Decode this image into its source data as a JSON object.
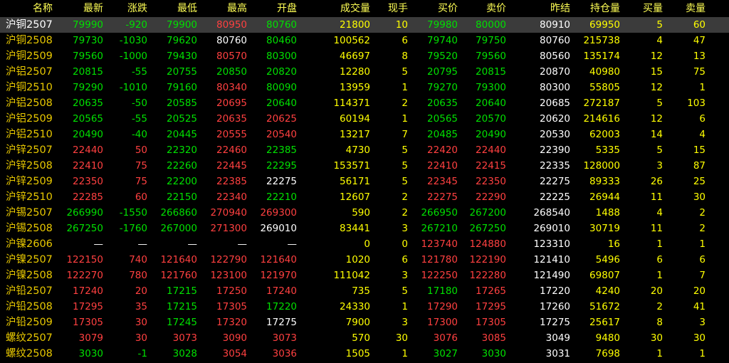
{
  "columns": [
    "名称",
    "最新",
    "涨跌",
    "最低",
    "最高",
    "开盘",
    "成交量",
    "现手",
    "买价",
    "卖价",
    "昨结",
    "持仓量",
    "买量",
    "卖量"
  ],
  "colors": {
    "up": "#ff4040",
    "down": "#00e000",
    "flat": "#ffffff",
    "volume": "#ffff00",
    "header": "#ffff55",
    "name": "#e8c800",
    "selected_bg": "#3b3b3b"
  },
  "rows": [
    {
      "name": "沪铜2507",
      "last": "79990",
      "chg": "-920",
      "low": "79900",
      "high": "80950",
      "open": "80760",
      "vol": "21800",
      "cur": "10",
      "bid": "79980",
      "ask": "80000",
      "prev": "80910",
      "oi": "69950",
      "bidv": "5",
      "askv": "60",
      "selected": true,
      "c": {
        "name": "w",
        "last": "g",
        "chg": "g",
        "low": "g",
        "high": "r",
        "open": "g",
        "bid": "g",
        "ask": "g",
        "prev": "w"
      }
    },
    {
      "name": "沪铜2508",
      "last": "79730",
      "chg": "-1030",
      "low": "79620",
      "high": "80760",
      "open": "80460",
      "vol": "100562",
      "cur": "6",
      "bid": "79740",
      "ask": "79750",
      "prev": "80760",
      "oi": "215738",
      "bidv": "4",
      "askv": "47",
      "c": {
        "name": "y",
        "last": "g",
        "chg": "g",
        "low": "g",
        "high": "w",
        "open": "g",
        "bid": "g",
        "ask": "g",
        "prev": "w"
      }
    },
    {
      "name": "沪铜2509",
      "last": "79560",
      "chg": "-1000",
      "low": "79430",
      "high": "80570",
      "open": "80300",
      "vol": "46697",
      "cur": "8",
      "bid": "79520",
      "ask": "79560",
      "prev": "80560",
      "oi": "135174",
      "bidv": "12",
      "askv": "13",
      "c": {
        "name": "y",
        "last": "g",
        "chg": "g",
        "low": "g",
        "high": "r",
        "open": "g",
        "bid": "g",
        "ask": "g",
        "prev": "w"
      }
    },
    {
      "name": "沪铝2507",
      "last": "20815",
      "chg": "-55",
      "low": "20755",
      "high": "20850",
      "open": "20820",
      "vol": "12280",
      "cur": "5",
      "bid": "20795",
      "ask": "20815",
      "prev": "20870",
      "oi": "40980",
      "bidv": "15",
      "askv": "75",
      "c": {
        "name": "y",
        "last": "g",
        "chg": "g",
        "low": "g",
        "high": "g",
        "open": "g",
        "bid": "g",
        "ask": "g",
        "prev": "w"
      }
    },
    {
      "name": "沪铜2510",
      "last": "79290",
      "chg": "-1010",
      "low": "79160",
      "high": "80340",
      "open": "80090",
      "vol": "13959",
      "cur": "1",
      "bid": "79270",
      "ask": "79300",
      "prev": "80300",
      "oi": "55805",
      "bidv": "12",
      "askv": "1",
      "c": {
        "name": "y",
        "last": "g",
        "chg": "g",
        "low": "g",
        "high": "r",
        "open": "g",
        "bid": "g",
        "ask": "g",
        "prev": "w"
      }
    },
    {
      "name": "沪铝2508",
      "last": "20635",
      "chg": "-50",
      "low": "20585",
      "high": "20695",
      "open": "20640",
      "vol": "114371",
      "cur": "2",
      "bid": "20635",
      "ask": "20640",
      "prev": "20685",
      "oi": "272187",
      "bidv": "5",
      "askv": "103",
      "c": {
        "name": "y",
        "last": "g",
        "chg": "g",
        "low": "g",
        "high": "r",
        "open": "g",
        "bid": "g",
        "ask": "g",
        "prev": "w"
      }
    },
    {
      "name": "沪铝2509",
      "last": "20565",
      "chg": "-55",
      "low": "20525",
      "high": "20635",
      "open": "20625",
      "vol": "60194",
      "cur": "1",
      "bid": "20565",
      "ask": "20570",
      "prev": "20620",
      "oi": "214616",
      "bidv": "12",
      "askv": "6",
      "c": {
        "name": "y",
        "last": "g",
        "chg": "g",
        "low": "g",
        "high": "r",
        "open": "r",
        "bid": "g",
        "ask": "g",
        "prev": "w"
      }
    },
    {
      "name": "沪铝2510",
      "last": "20490",
      "chg": "-40",
      "low": "20445",
      "high": "20555",
      "open": "20540",
      "vol": "13217",
      "cur": "7",
      "bid": "20485",
      "ask": "20490",
      "prev": "20530",
      "oi": "62003",
      "bidv": "14",
      "askv": "4",
      "c": {
        "name": "y",
        "last": "g",
        "chg": "g",
        "low": "g",
        "high": "r",
        "open": "r",
        "bid": "g",
        "ask": "g",
        "prev": "w"
      }
    },
    {
      "name": "沪锌2507",
      "last": "22440",
      "chg": "50",
      "low": "22320",
      "high": "22460",
      "open": "22385",
      "vol": "4730",
      "cur": "5",
      "bid": "22420",
      "ask": "22440",
      "prev": "22390",
      "oi": "5335",
      "bidv": "5",
      "askv": "15",
      "c": {
        "name": "y",
        "last": "r",
        "chg": "r",
        "low": "g",
        "high": "r",
        "open": "g",
        "bid": "r",
        "ask": "r",
        "prev": "w"
      }
    },
    {
      "name": "沪锌2508",
      "last": "22410",
      "chg": "75",
      "low": "22260",
      "high": "22445",
      "open": "22295",
      "vol": "153571",
      "cur": "5",
      "bid": "22410",
      "ask": "22415",
      "prev": "22335",
      "oi": "128000",
      "bidv": "3",
      "askv": "87",
      "c": {
        "name": "y",
        "last": "r",
        "chg": "r",
        "low": "g",
        "high": "r",
        "open": "g",
        "bid": "r",
        "ask": "r",
        "prev": "w"
      }
    },
    {
      "name": "沪锌2509",
      "last": "22350",
      "chg": "75",
      "low": "22200",
      "high": "22385",
      "open": "22275",
      "vol": "56171",
      "cur": "5",
      "bid": "22345",
      "ask": "22350",
      "prev": "22275",
      "oi": "89333",
      "bidv": "26",
      "askv": "25",
      "c": {
        "name": "y",
        "last": "r",
        "chg": "r",
        "low": "g",
        "high": "r",
        "open": "w",
        "bid": "r",
        "ask": "r",
        "prev": "w"
      }
    },
    {
      "name": "沪锌2510",
      "last": "22285",
      "chg": "60",
      "low": "22150",
      "high": "22340",
      "open": "22210",
      "vol": "12607",
      "cur": "2",
      "bid": "22275",
      "ask": "22290",
      "prev": "22225",
      "oi": "26944",
      "bidv": "11",
      "askv": "30",
      "c": {
        "name": "y",
        "last": "r",
        "chg": "r",
        "low": "g",
        "high": "r",
        "open": "g",
        "bid": "r",
        "ask": "r",
        "prev": "w"
      }
    },
    {
      "name": "沪锡2507",
      "last": "266990",
      "chg": "-1550",
      "low": "266860",
      "high": "270940",
      "open": "269300",
      "vol": "590",
      "cur": "2",
      "bid": "266950",
      "ask": "267200",
      "prev": "268540",
      "oi": "1488",
      "bidv": "4",
      "askv": "2",
      "c": {
        "name": "y",
        "last": "g",
        "chg": "g",
        "low": "g",
        "high": "r",
        "open": "r",
        "bid": "g",
        "ask": "g",
        "prev": "w"
      }
    },
    {
      "name": "沪锡2508",
      "last": "267250",
      "chg": "-1760",
      "low": "267000",
      "high": "271300",
      "open": "269010",
      "vol": "83441",
      "cur": "3",
      "bid": "267210",
      "ask": "267250",
      "prev": "269010",
      "oi": "30719",
      "bidv": "11",
      "askv": "2",
      "c": {
        "name": "y",
        "last": "g",
        "chg": "g",
        "low": "g",
        "high": "r",
        "open": "w",
        "bid": "g",
        "ask": "g",
        "prev": "w"
      }
    },
    {
      "name": "沪镍2606",
      "last": "—",
      "chg": "—",
      "low": "—",
      "high": "—",
      "open": "—",
      "vol": "0",
      "cur": "0",
      "bid": "123740",
      "ask": "124880",
      "prev": "123310",
      "oi": "16",
      "bidv": "1",
      "askv": "1",
      "c": {
        "name": "y",
        "last": "w",
        "chg": "w",
        "low": "w",
        "high": "w",
        "open": "w",
        "bid": "r",
        "ask": "r",
        "prev": "w"
      }
    },
    {
      "name": "沪镍2507",
      "last": "122150",
      "chg": "740",
      "low": "121640",
      "high": "122790",
      "open": "121640",
      "vol": "1020",
      "cur": "6",
      "bid": "121780",
      "ask": "122190",
      "prev": "121410",
      "oi": "5496",
      "bidv": "6",
      "askv": "6",
      "c": {
        "name": "y",
        "last": "r",
        "chg": "r",
        "low": "r",
        "high": "r",
        "open": "r",
        "bid": "r",
        "ask": "r",
        "prev": "w"
      }
    },
    {
      "name": "沪镍2508",
      "last": "122270",
      "chg": "780",
      "low": "121760",
      "high": "123100",
      "open": "121970",
      "vol": "111042",
      "cur": "3",
      "bid": "122250",
      "ask": "122280",
      "prev": "121490",
      "oi": "69807",
      "bidv": "1",
      "askv": "7",
      "c": {
        "name": "y",
        "last": "r",
        "chg": "r",
        "low": "r",
        "high": "r",
        "open": "r",
        "bid": "r",
        "ask": "r",
        "prev": "w"
      }
    },
    {
      "name": "沪铅2507",
      "last": "17240",
      "chg": "20",
      "low": "17215",
      "high": "17250",
      "open": "17240",
      "vol": "735",
      "cur": "5",
      "bid": "17180",
      "ask": "17265",
      "prev": "17220",
      "oi": "4240",
      "bidv": "20",
      "askv": "20",
      "c": {
        "name": "y",
        "last": "r",
        "chg": "r",
        "low": "g",
        "high": "r",
        "open": "r",
        "bid": "g",
        "ask": "r",
        "prev": "w"
      }
    },
    {
      "name": "沪铅2508",
      "last": "17295",
      "chg": "35",
      "low": "17215",
      "high": "17305",
      "open": "17220",
      "vol": "24330",
      "cur": "1",
      "bid": "17290",
      "ask": "17295",
      "prev": "17260",
      "oi": "51672",
      "bidv": "2",
      "askv": "41",
      "c": {
        "name": "y",
        "last": "r",
        "chg": "r",
        "low": "g",
        "high": "r",
        "open": "g",
        "bid": "r",
        "ask": "r",
        "prev": "w"
      }
    },
    {
      "name": "沪铅2509",
      "last": "17305",
      "chg": "30",
      "low": "17245",
      "high": "17320",
      "open": "17275",
      "vol": "7900",
      "cur": "3",
      "bid": "17300",
      "ask": "17305",
      "prev": "17275",
      "oi": "25617",
      "bidv": "8",
      "askv": "3",
      "c": {
        "name": "y",
        "last": "r",
        "chg": "r",
        "low": "g",
        "high": "r",
        "open": "w",
        "bid": "r",
        "ask": "r",
        "prev": "w"
      }
    },
    {
      "name": "螺纹2507",
      "last": "3079",
      "chg": "30",
      "low": "3073",
      "high": "3090",
      "open": "3073",
      "vol": "570",
      "cur": "30",
      "bid": "3076",
      "ask": "3085",
      "prev": "3049",
      "oi": "9480",
      "bidv": "30",
      "askv": "30",
      "c": {
        "name": "y",
        "last": "r",
        "chg": "r",
        "low": "r",
        "high": "r",
        "open": "r",
        "bid": "r",
        "ask": "r",
        "prev": "w"
      }
    },
    {
      "name": "螺纹2508",
      "last": "3030",
      "chg": "-1",
      "low": "3028",
      "high": "3054",
      "open": "3036",
      "vol": "1505",
      "cur": "1",
      "bid": "3027",
      "ask": "3030",
      "prev": "3031",
      "oi": "7698",
      "bidv": "1",
      "askv": "1",
      "c": {
        "name": "y",
        "last": "g",
        "chg": "g",
        "low": "g",
        "high": "r",
        "open": "r",
        "bid": "g",
        "ask": "g",
        "prev": "w"
      }
    }
  ]
}
